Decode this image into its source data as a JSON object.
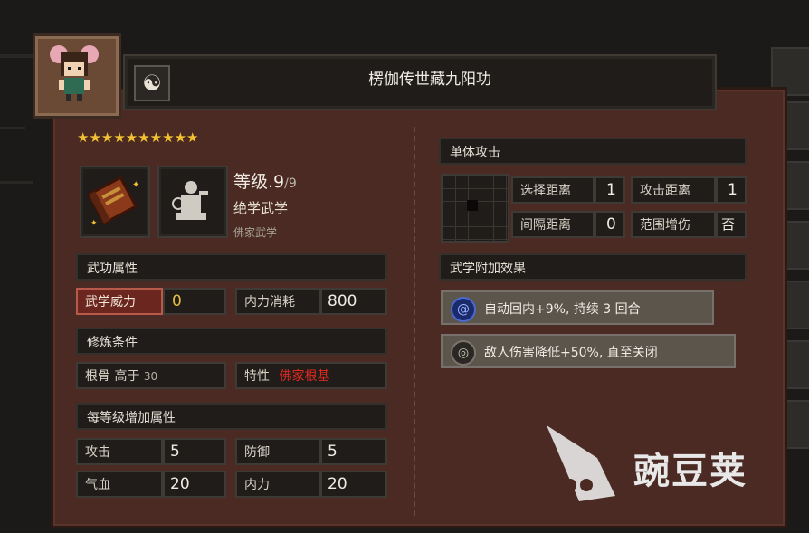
{
  "title": "楞伽传世藏九阳功",
  "title_icon": "yin-yang-icon",
  "stars": "★★★★★★★★★★",
  "level": {
    "label": "等级",
    "value": ".9",
    "max": "/9"
  },
  "rank": "绝学武学",
  "school": "佛家武学",
  "left": {
    "sections": {
      "attributes": "武功属性",
      "requirements": "修炼条件",
      "per_level": "每等级增加属性"
    },
    "power": {
      "label": "武学威力",
      "value": "0"
    },
    "mp_cost": {
      "label": "内力消耗",
      "value": "800"
    },
    "req_bone": {
      "label": "根骨 高于",
      "value": "30"
    },
    "req_trait": {
      "label": "特性",
      "value": "佛家根基"
    },
    "attack": {
      "label": "攻击",
      "value": "5"
    },
    "defense": {
      "label": "防御",
      "value": "5"
    },
    "hp": {
      "label": "气血",
      "value": "20"
    },
    "mp": {
      "label": "内力",
      "value": "20"
    }
  },
  "right": {
    "target_type": "单体攻击",
    "select_range": {
      "label": "选择距离",
      "value": "1"
    },
    "attack_range": {
      "label": "攻击距离",
      "value": "1"
    },
    "interval_range": {
      "label": "间隔距离",
      "value": "0"
    },
    "area_damage": {
      "label": "范围增伤",
      "value": "否"
    },
    "effects_head": "武学附加效果",
    "effects": [
      {
        "icon": "swirl-icon",
        "text": "自动回内+9%, 持续 3 回合"
      },
      {
        "icon": "target-icon",
        "text": "敌人伤害降低+50%, 直至关闭"
      }
    ]
  },
  "watermark": "豌豆荚",
  "colors": {
    "gold": "#e8c040",
    "red": "#e02a20",
    "panel": "#4a2a22",
    "highlight": "#6b2620"
  }
}
